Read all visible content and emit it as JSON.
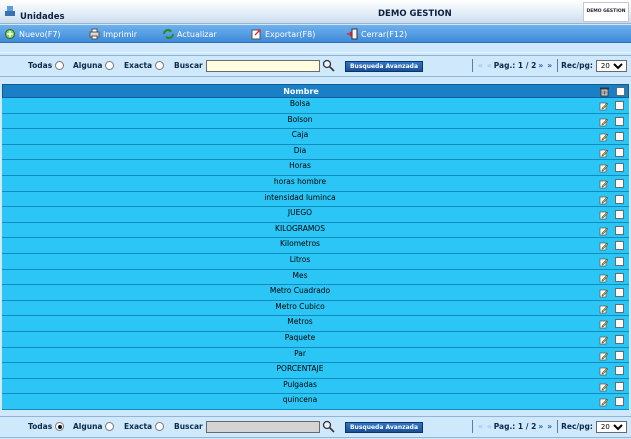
{
  "window": {
    "title": "Unidades",
    "company": "DEMO GESTION",
    "logo_text": "DEMO GESTION"
  },
  "toolbar": {
    "nuevo": "Nuevo(F7)",
    "imprimir": "Imprimir",
    "actualizar": "Actualizar",
    "exportar": "Exportar(F8)",
    "cerrar": "Cerrar(F12)"
  },
  "filters": {
    "todas": "Todas",
    "alguna": "Alguna",
    "exacta": "Exacta",
    "buscar": "Buscar",
    "advanced": "Busqueda Avanzada",
    "search_value": ""
  },
  "pager": {
    "first": "«",
    "prev": "«",
    "label": "Pag.:",
    "current": "1",
    "slash": "/",
    "total": "2",
    "next": "»",
    "last": "»",
    "rec_label": "Rec/pg:",
    "rec_value": "20"
  },
  "grid": {
    "header": "Nombre",
    "rows": [
      "Bolsa",
      "Bolson",
      "Caja",
      "Dia",
      "Horas",
      "horas hombre",
      "intensidad luminca",
      "JUEGO",
      "KILOGRAMOS",
      "Kilometros",
      "Litros",
      "Mes",
      "Metro Cuadrado",
      "Metro Cubico",
      "Metros",
      "Paquete",
      "Par",
      "PORCENTAJE",
      "Pulgadas",
      "quincena"
    ]
  },
  "colors": {
    "toolbar": "#3e8ad9",
    "header": "#1b7fc6",
    "row": "#2bc6f5",
    "page": "#cfe8fb"
  }
}
